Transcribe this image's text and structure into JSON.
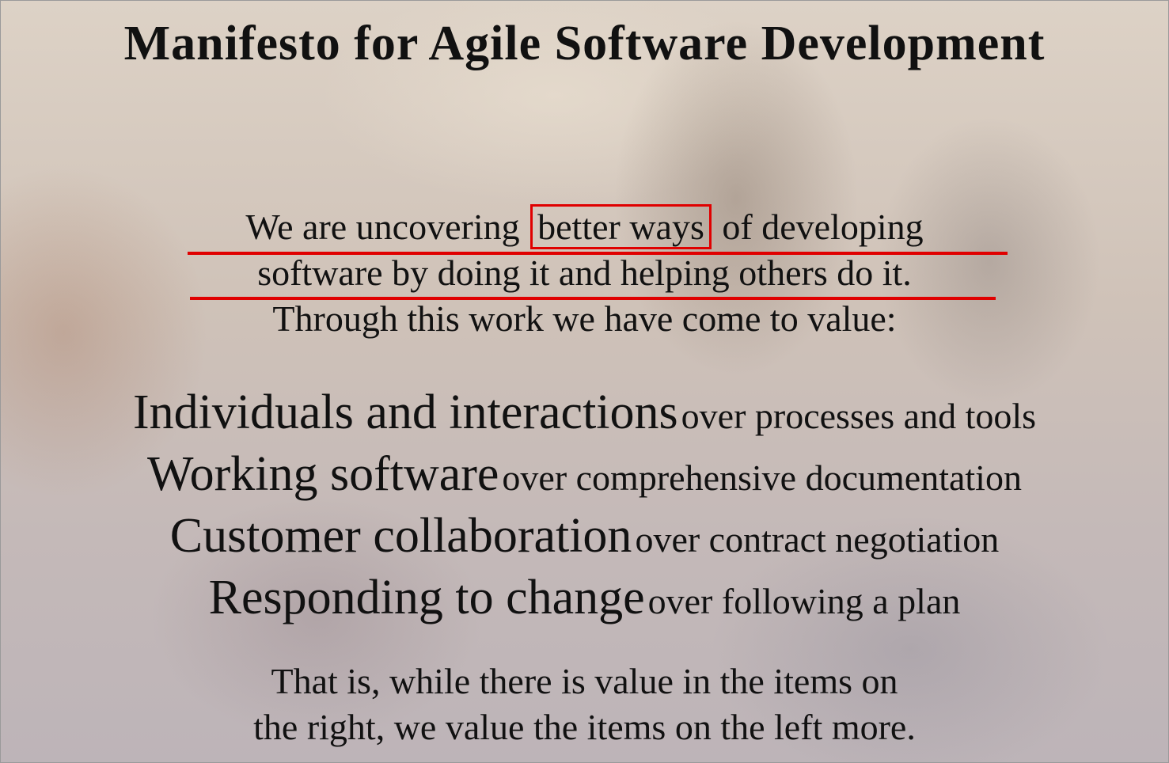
{
  "title": "Manifesto for Agile Software Development",
  "intro": {
    "line1_before": "We are uncovering",
    "line1_highlight": "better ways",
    "line1_after": "of developing",
    "line2": "software by doing it and helping others do it.",
    "line3": "Through this work we have come to value:"
  },
  "values": [
    {
      "left": "Individuals and interactions",
      "right": "over processes and tools"
    },
    {
      "left": "Working software",
      "right": "over comprehensive documentation"
    },
    {
      "left": "Customer collaboration",
      "right": "over contract negotiation"
    },
    {
      "left": "Responding to change",
      "right": "over following a plan"
    }
  ],
  "closing": {
    "line1": "That is, while there is value in the items on",
    "line2": "the right, we value the items on the left more."
  },
  "colors": {
    "annotation": "#e00000",
    "text": "#111111"
  }
}
